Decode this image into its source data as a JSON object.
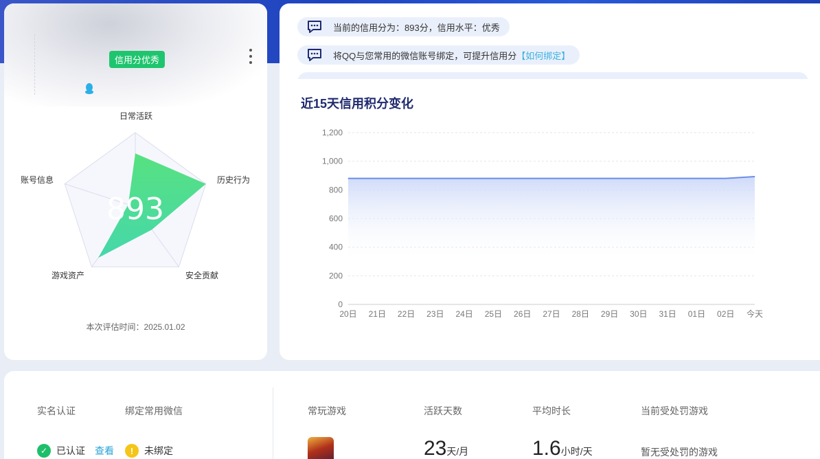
{
  "profile": {
    "credit_badge": "信用分优秀",
    "score": "893",
    "eval_time": "本次评估时间：2025.01.02"
  },
  "radar": {
    "labels": [
      "日常活跃",
      "历史行为",
      "安全贡献",
      "游戏资产",
      "账号信息"
    ],
    "values": [
      0.72,
      1.0,
      0.38,
      0.85,
      0.1
    ],
    "fill_colors": [
      "#4fe07a",
      "#3cd6a6"
    ],
    "grid_color": "#d9dcec"
  },
  "notices": [
    {
      "text": "当前的信用分为：893分，信用水平：优秀",
      "link": ""
    },
    {
      "text": "将QQ与您常用的微信账号绑定，可提升信用分",
      "link": "【如何绑定】"
    }
  ],
  "chart_title": "近15天信用积分变化",
  "chart_data": {
    "type": "area",
    "categories": [
      "20日",
      "21日",
      "22日",
      "23日",
      "24日",
      "25日",
      "26日",
      "27日",
      "28日",
      "29日",
      "30日",
      "31日",
      "01日",
      "02日",
      "今天"
    ],
    "values": [
      880,
      880,
      880,
      880,
      880,
      880,
      880,
      880,
      880,
      880,
      880,
      880,
      880,
      880,
      893
    ],
    "ylim": [
      0,
      1200
    ],
    "yticks": [
      "0",
      "200",
      "400",
      "600",
      "800",
      "1,000",
      "1,200"
    ],
    "line_color": "#6a8ee8",
    "fill_color": "#c9d6f8",
    "grid": true
  },
  "bottom": {
    "realname_header": "实名认证",
    "wechat_header": "绑定常用微信",
    "realname_status": "已认证",
    "realname_view": "查看",
    "wechat_status": "未绑定",
    "games_header": "常玩游戏",
    "active_days_header": "活跃天数",
    "avg_time_header": "平均时长",
    "penalty_header": "当前受处罚游戏",
    "active_days_value": "23",
    "active_days_unit": "天/月",
    "avg_time_value": "1.6",
    "avg_time_unit": "小时/天",
    "penalty_value": "暂无受处罚的游戏"
  }
}
